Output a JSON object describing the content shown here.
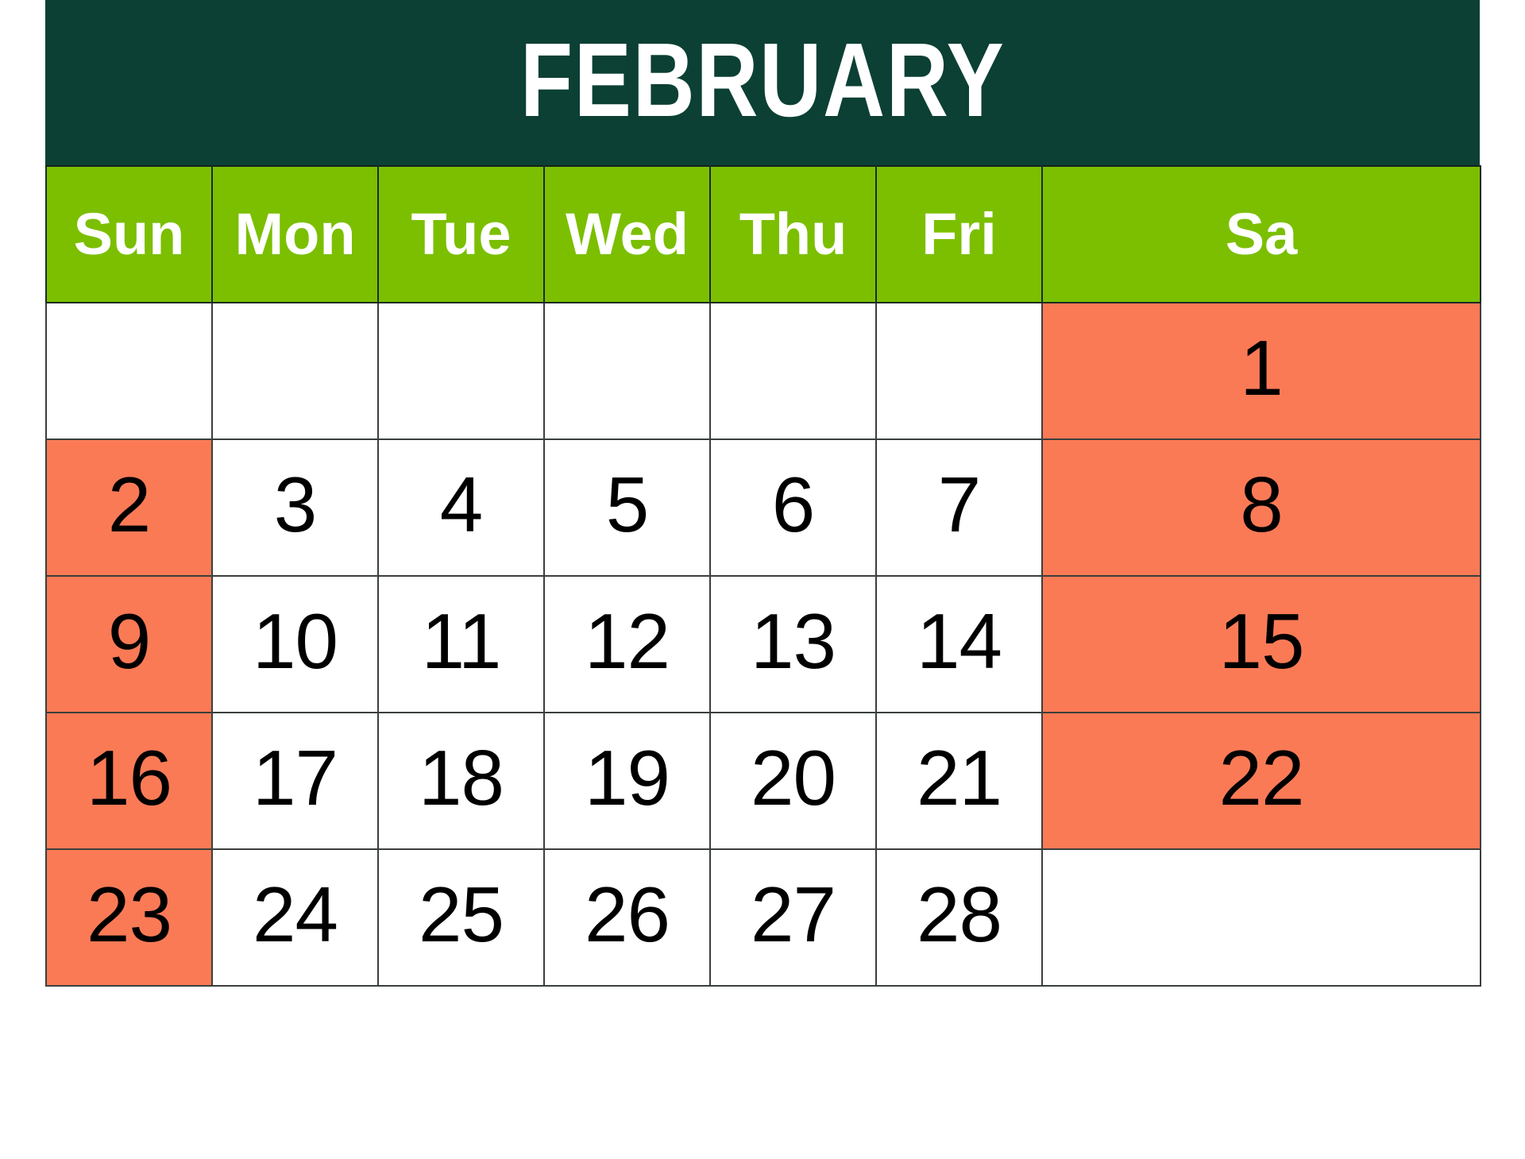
{
  "calendar": {
    "month_title": "FEBRUARY",
    "colors": {
      "title_bar_bg": "#0C4034",
      "title_text": "#FFFFFF",
      "dow_bg": "#7BBF00",
      "dow_text": "#FFFFFF",
      "weekend_bg": "#FB7A56",
      "weekday_bg": "#FFFFFF",
      "day_text": "#000000",
      "grid_line": "#3A3F3C"
    },
    "day_headers": [
      {
        "label": "Sun",
        "name": "sunday"
      },
      {
        "label": "Mon",
        "name": "monday"
      },
      {
        "label": "Tue",
        "name": "tuesday"
      },
      {
        "label": "Wed",
        "name": "wednesday"
      },
      {
        "label": "Thu",
        "name": "thursday"
      },
      {
        "label": "Fri",
        "name": "friday"
      },
      {
        "label": "Sa",
        "name": "saturday"
      }
    ],
    "weeks": [
      {
        "cells": [
          {
            "label": "",
            "highlight": false,
            "empty": true
          },
          {
            "label": "",
            "highlight": false,
            "empty": true
          },
          {
            "label": "",
            "highlight": false,
            "empty": true
          },
          {
            "label": "",
            "highlight": false,
            "empty": true
          },
          {
            "label": "",
            "highlight": false,
            "empty": true
          },
          {
            "label": "",
            "highlight": false,
            "empty": true
          },
          {
            "label": "1",
            "highlight": true,
            "empty": false
          }
        ]
      },
      {
        "cells": [
          {
            "label": "2",
            "highlight": true,
            "empty": false
          },
          {
            "label": "3",
            "highlight": false,
            "empty": false
          },
          {
            "label": "4",
            "highlight": false,
            "empty": false
          },
          {
            "label": "5",
            "highlight": false,
            "empty": false
          },
          {
            "label": "6",
            "highlight": false,
            "empty": false
          },
          {
            "label": "7",
            "highlight": false,
            "empty": false
          },
          {
            "label": "8",
            "highlight": true,
            "empty": false
          }
        ]
      },
      {
        "cells": [
          {
            "label": "9",
            "highlight": true,
            "empty": false
          },
          {
            "label": "10",
            "highlight": false,
            "empty": false
          },
          {
            "label": "11",
            "highlight": false,
            "empty": false
          },
          {
            "label": "12",
            "highlight": false,
            "empty": false
          },
          {
            "label": "13",
            "highlight": false,
            "empty": false
          },
          {
            "label": "14",
            "highlight": false,
            "empty": false
          },
          {
            "label": "15",
            "highlight": true,
            "empty": false
          }
        ]
      },
      {
        "cells": [
          {
            "label": "16",
            "highlight": true,
            "empty": false
          },
          {
            "label": "17",
            "highlight": false,
            "empty": false
          },
          {
            "label": "18",
            "highlight": false,
            "empty": false
          },
          {
            "label": "19",
            "highlight": false,
            "empty": false
          },
          {
            "label": "20",
            "highlight": false,
            "empty": false
          },
          {
            "label": "21",
            "highlight": false,
            "empty": false
          },
          {
            "label": "22",
            "highlight": true,
            "empty": false
          }
        ]
      },
      {
        "cells": [
          {
            "label": "23",
            "highlight": true,
            "empty": false
          },
          {
            "label": "24",
            "highlight": false,
            "empty": false
          },
          {
            "label": "25",
            "highlight": false,
            "empty": false
          },
          {
            "label": "26",
            "highlight": false,
            "empty": false
          },
          {
            "label": "27",
            "highlight": false,
            "empty": false
          },
          {
            "label": "28",
            "highlight": false,
            "empty": false
          },
          {
            "label": "",
            "highlight": false,
            "empty": true
          }
        ]
      }
    ]
  }
}
